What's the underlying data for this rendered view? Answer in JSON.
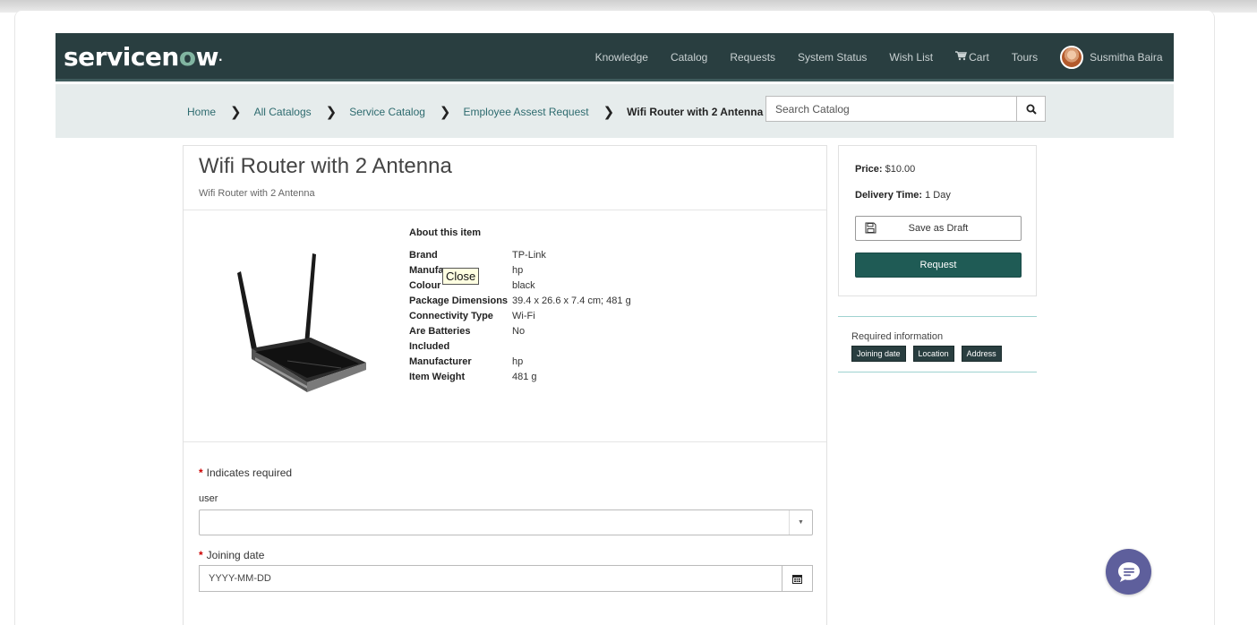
{
  "app": {
    "logo_pre": "servicen",
    "logo_o": "o",
    "logo_post": "w",
    "logo_dot": "."
  },
  "nav": {
    "items": [
      "Knowledge",
      "Catalog",
      "Requests",
      "System Status",
      "Wish List",
      "Cart",
      "Tours"
    ],
    "user_name": "Susmitha Baira"
  },
  "breadcrumb": {
    "items": [
      "Home",
      "All Catalogs",
      "Service Catalog",
      "Employee Assest Request"
    ],
    "current": "Wifi Router with 2 Antenna"
  },
  "search": {
    "placeholder": "Search Catalog"
  },
  "item": {
    "title": "Wifi Router with 2 Antenna",
    "subtitle": "Wifi Router with 2 Antenna",
    "about_title": "About this item",
    "specs": [
      {
        "key": "Brand",
        "value": "TP-Link"
      },
      {
        "key": "Manufa",
        "value": "hp"
      },
      {
        "key": "Colour",
        "value": "black"
      },
      {
        "key": "Package Dimensions",
        "value": "39.4 x 26.6 x 7.4 cm; 481 g"
      },
      {
        "key": "Connectivity Type",
        "value": "Wi-Fi"
      },
      {
        "key": "Are Batteries Included",
        "value": "No"
      },
      {
        "key": "Manufacturer",
        "value": "hp"
      },
      {
        "key": "Item Weight",
        "value": "481 g"
      }
    ],
    "tooltip": "Close"
  },
  "form": {
    "required_note": "Indicates required",
    "required_star": "*",
    "user_label": "user",
    "user_value": "",
    "joining_label": "Joining date",
    "joining_placeholder": "YYYY-MM-DD"
  },
  "order": {
    "price_label": "Price:",
    "price_value": "$10.00",
    "delivery_label": "Delivery Time:",
    "delivery_value": "1 Day",
    "save_draft": "Save as Draft",
    "request": "Request"
  },
  "required_info": {
    "title": "Required information",
    "tags": [
      "Joining date",
      "Location",
      "Address"
    ]
  },
  "colors": {
    "header": "#293e40",
    "accent": "#81b5a1",
    "primary_button": "#1f5b55",
    "link": "#2e6b6f",
    "chat": "#5e5f9c"
  }
}
